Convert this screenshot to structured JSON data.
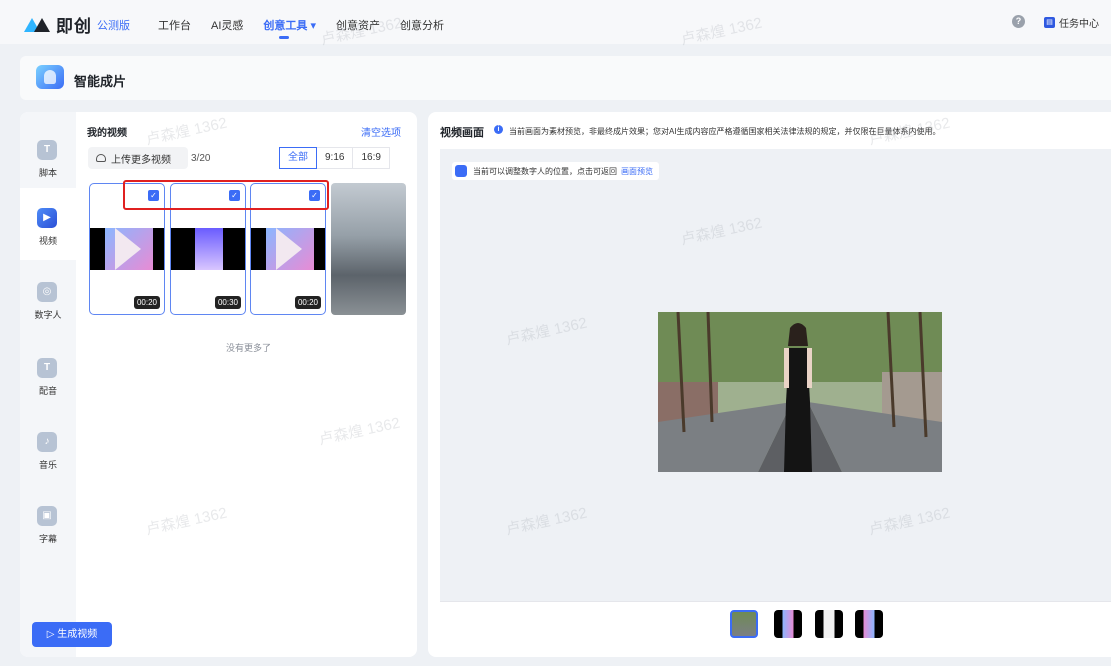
{
  "topbar": {
    "logo_text": "即创",
    "beta_badge": "公测版",
    "nav": [
      {
        "label": "工作台"
      },
      {
        "label": "AI灵感"
      },
      {
        "label": "创意工具 ▾",
        "active": true
      },
      {
        "label": "创意资产"
      },
      {
        "label": "创意分析"
      }
    ],
    "help_icon": "?",
    "task_center": "任务中心"
  },
  "page": {
    "title": "智能成片"
  },
  "sidebar": {
    "items": [
      {
        "label": "脚本",
        "icon": "script-icon",
        "glyph": "T"
      },
      {
        "label": "视频",
        "icon": "video-icon",
        "glyph": "▶",
        "active": true
      },
      {
        "label": "数字人",
        "icon": "avatar-icon",
        "glyph": "◎"
      },
      {
        "label": "配音",
        "icon": "voice-icon",
        "glyph": "T"
      },
      {
        "label": "音乐",
        "icon": "music-icon",
        "glyph": "♪"
      },
      {
        "label": "字幕",
        "icon": "subtitle-icon",
        "glyph": "▣"
      }
    ]
  },
  "my_videos": {
    "title": "我的视频",
    "clear_label": "清空选项",
    "upload_label": "上传更多视频",
    "count": "3/20",
    "filters": [
      "全部",
      "9:16",
      "16:9"
    ],
    "videos": [
      {
        "duration": "00:20",
        "checked": true
      },
      {
        "duration": "00:30",
        "checked": true
      },
      {
        "duration": "00:20",
        "checked": true
      }
    ],
    "check_glyph": "✓",
    "no_more": "没有更多了"
  },
  "generate_button": "▷ 生成视频",
  "preview": {
    "title": "视频画面",
    "info_glyph": "i",
    "notice": "当前画面为素材预览，非最终成片效果；您对AI生成内容应严格遵循国家相关法律法规的规定，并仅限在巨量体系内使用。",
    "tip": "当前可以调整数字人的位置，点击可返回",
    "tip_link": "画面预览"
  },
  "watermark": "卢森煌 1362",
  "colors": {
    "accent": "#3b6cf6",
    "highlight_box": "#e02020"
  }
}
